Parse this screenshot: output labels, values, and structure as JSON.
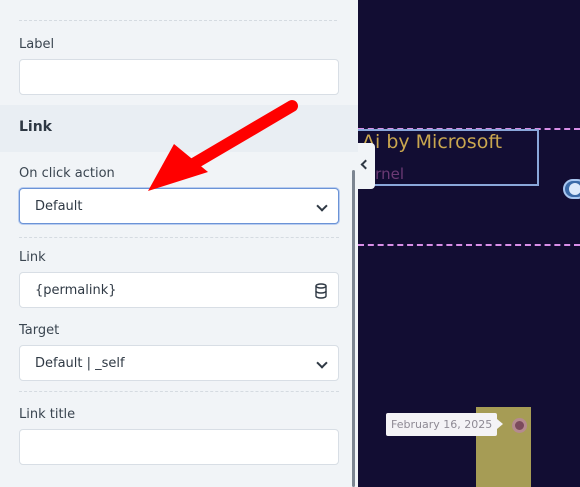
{
  "panel": {
    "label_field": {
      "label": "Label",
      "value": ""
    },
    "section_title": "Link",
    "on_click": {
      "label": "On click action",
      "value": "Default"
    },
    "link": {
      "label": "Link",
      "value": "{permalink}"
    },
    "target": {
      "label": "Target",
      "value": "Default | _self"
    },
    "link_title": {
      "label": "Link title",
      "value": ""
    }
  },
  "canvas": {
    "title": "Ai by Microsoft",
    "subtitle": "ornel",
    "date_tag": "February 16, 2025"
  },
  "icons": [
    "chevron-down-icon",
    "database-icon",
    "chevron-left-icon",
    "lock-icon",
    "red-arrow-annotation"
  ],
  "colors": {
    "annotation": "#ff0000",
    "canvas_bg": "#120d33",
    "title": "#c9a64f",
    "dash": "#d88ee8"
  }
}
